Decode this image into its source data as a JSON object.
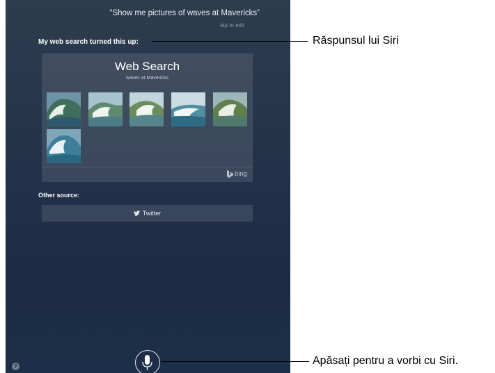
{
  "siri": {
    "utterance": "“Show me pictures of waves at Mavericks”",
    "tap_to_edit": "tap to edit",
    "response_heading": "My web search turned this up:",
    "other_source_heading": "Other source:",
    "help_label": "?"
  },
  "web_search": {
    "title": "Web Search",
    "query": "waves at Mavericks",
    "provider": "bing",
    "images": [
      "wave-photo",
      "wave-photo",
      "wave-photo",
      "wave-photo",
      "wave-photo",
      "wave-photo"
    ]
  },
  "other_sources": [
    {
      "label": "Twitter",
      "icon": "twitter-bird-icon"
    }
  ],
  "microphone": {
    "icon": "microphone-icon"
  },
  "callouts": {
    "response": "Răspunsul lui Siri",
    "speak": "Apăsați pentru a vorbi cu Siri."
  },
  "colors": {
    "screen_top": "#2d3c4e",
    "screen_bottom": "#1d2f48",
    "card_fill": "rgba(255,255,255,0.11)",
    "text_primary": "#ffffff"
  }
}
